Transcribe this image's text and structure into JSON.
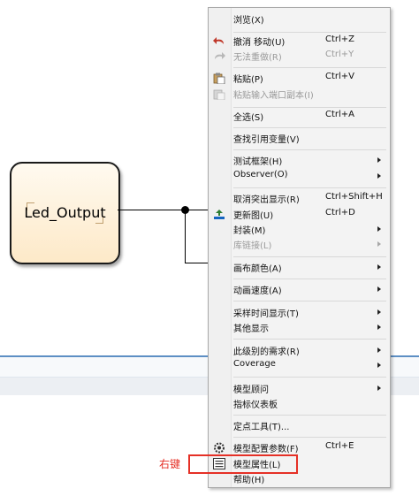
{
  "canvas": {
    "block": {
      "label": "Led_Output"
    }
  },
  "context_menu": {
    "items": [
      {
        "label": "浏览(X)",
        "shortcut": "",
        "disabled": false,
        "submenu": false,
        "icon": ""
      },
      {
        "label": "撤消 移动(U)",
        "shortcut": "Ctrl+Z",
        "disabled": false,
        "submenu": false,
        "icon": "undo-icon"
      },
      {
        "label": "无法重做(R)",
        "shortcut": "Ctrl+Y",
        "disabled": true,
        "submenu": false,
        "icon": "redo-icon"
      },
      {
        "label": "粘贴(P)",
        "shortcut": "Ctrl+V",
        "disabled": false,
        "submenu": false,
        "icon": "paste-icon"
      },
      {
        "label": "粘贴输入端口副本(I)",
        "shortcut": "",
        "disabled": true,
        "submenu": false,
        "icon": "paste-port-icon"
      },
      {
        "label": "全选(S)",
        "shortcut": "Ctrl+A",
        "disabled": false,
        "submenu": false,
        "icon": ""
      },
      {
        "label": "查找引用变量(V)",
        "shortcut": "",
        "disabled": false,
        "submenu": false,
        "icon": ""
      },
      {
        "label": "测试框架(H)",
        "shortcut": "",
        "disabled": false,
        "submenu": true,
        "icon": ""
      },
      {
        "label": "Observer(O)",
        "shortcut": "",
        "disabled": false,
        "submenu": true,
        "icon": ""
      },
      {
        "label": "取消突出显示(R)",
        "shortcut": "Ctrl+Shift+H",
        "disabled": false,
        "submenu": false,
        "icon": ""
      },
      {
        "label": "更新图(U)",
        "shortcut": "Ctrl+D",
        "disabled": false,
        "submenu": false,
        "icon": "update-diagram-icon"
      },
      {
        "label": "封装(M)",
        "shortcut": "",
        "disabled": false,
        "submenu": true,
        "icon": ""
      },
      {
        "label": "库链接(L)",
        "shortcut": "",
        "disabled": true,
        "submenu": true,
        "icon": ""
      },
      {
        "label": "画布颜色(A)",
        "shortcut": "",
        "disabled": false,
        "submenu": true,
        "icon": ""
      },
      {
        "label": "动画速度(A)",
        "shortcut": "",
        "disabled": false,
        "submenu": true,
        "icon": ""
      },
      {
        "label": "采样时间显示(T)",
        "shortcut": "",
        "disabled": false,
        "submenu": true,
        "icon": ""
      },
      {
        "label": "其他显示",
        "shortcut": "",
        "disabled": false,
        "submenu": true,
        "icon": ""
      },
      {
        "label": "此级别的需求(R)",
        "shortcut": "",
        "disabled": false,
        "submenu": true,
        "icon": ""
      },
      {
        "label": "Coverage",
        "shortcut": "",
        "disabled": false,
        "submenu": true,
        "icon": ""
      },
      {
        "label": "模型顾问",
        "shortcut": "",
        "disabled": false,
        "submenu": true,
        "icon": ""
      },
      {
        "label": "指标仪表板",
        "shortcut": "",
        "disabled": false,
        "submenu": false,
        "icon": ""
      },
      {
        "label": "定点工具(T)...",
        "shortcut": "",
        "disabled": false,
        "submenu": false,
        "icon": ""
      },
      {
        "label": "模型配置参数(F)",
        "shortcut": "Ctrl+E",
        "disabled": false,
        "submenu": false,
        "icon": "gear-icon"
      },
      {
        "label": "模型属性(L)",
        "shortcut": "",
        "disabled": false,
        "submenu": false,
        "icon": "properties-list-icon"
      },
      {
        "label": "帮助(H)",
        "shortcut": "",
        "disabled": false,
        "submenu": false,
        "icon": ""
      }
    ]
  },
  "annotation": {
    "label": "右键",
    "color": "#e53026"
  },
  "colors": {
    "menu_bg": "#f3f3f3",
    "block_fill": "#fde9c8",
    "accent_line": "#5d8fc4"
  }
}
